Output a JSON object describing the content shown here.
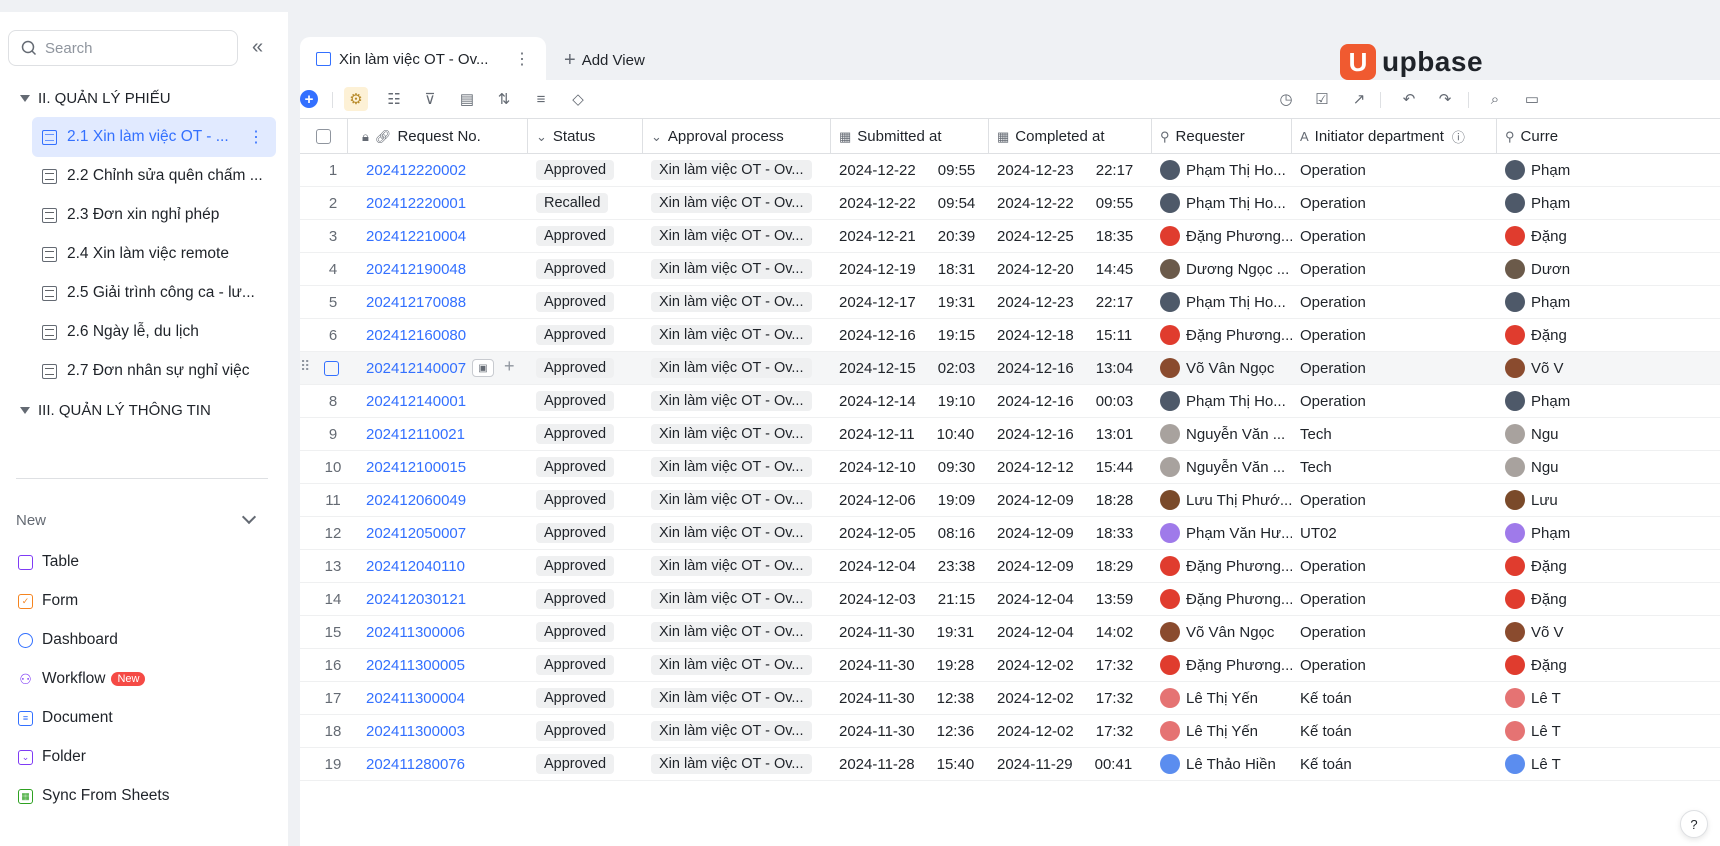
{
  "sidebar": {
    "search_placeholder": "Search",
    "groups": [
      {
        "label": "II. QUẢN LÝ PHIẾU"
      },
      {
        "label": "III. QUẢN LÝ THÔNG TIN"
      }
    ],
    "items": [
      {
        "label": "2.1 Xin làm việc OT - ..."
      },
      {
        "label": "2.2 Chỉnh sửa quên chấm ..."
      },
      {
        "label": "2.3 Đơn xin nghỉ phép"
      },
      {
        "label": "2.4 Xin làm việc remote"
      },
      {
        "label": "2.5 Giải trình công ca - lư..."
      },
      {
        "label": "2.6 Ngày lễ, du lịch"
      },
      {
        "label": "2.7 Đơn nhân sự nghỉ việc"
      }
    ],
    "new_label": "New",
    "new_items": [
      {
        "label": "Table",
        "icon": "table-icon",
        "color": "#7f3bf5"
      },
      {
        "label": "Form",
        "icon": "form-icon",
        "color": "#f5841f"
      },
      {
        "label": "Dashboard",
        "icon": "dashboard-icon",
        "color": "#3370ff"
      },
      {
        "label": "Workflow",
        "icon": "workflow-icon",
        "color": "#7f3bf5",
        "badge": "New"
      },
      {
        "label": "Document",
        "icon": "document-icon",
        "color": "#3370ff"
      },
      {
        "label": "Folder",
        "icon": "folder-icon",
        "color": "#7f3bf5"
      },
      {
        "label": "Sync From Sheets",
        "icon": "sheets-icon",
        "color": "#2ea121"
      }
    ]
  },
  "tabs": {
    "active_label": "Xin làm việc OT - Ov...",
    "add_view_label": "Add View"
  },
  "brand": {
    "name": "upbase",
    "color": "#f05a30"
  },
  "table": {
    "columns": [
      "Request No.",
      "Status",
      "Approval process",
      "Submitted at",
      "Completed at",
      "Requester",
      "Initiator department",
      "Curre"
    ],
    "rows": [
      {
        "n": "1",
        "req": "202412220002",
        "status": "Approved",
        "proc": "Xin làm việc OT - Ov...",
        "sd": "2024-12-22",
        "st": "09:55",
        "cd": "2024-12-23",
        "ct": "22:17",
        "requester": "Phạm Thị Ho...",
        "dept": "Operation",
        "cur": "Phạm",
        "av": "#4e5969"
      },
      {
        "n": "2",
        "req": "202412220001",
        "status": "Recalled",
        "proc": "Xin làm việc OT - Ov...",
        "sd": "2024-12-22",
        "st": "09:54",
        "cd": "2024-12-22",
        "ct": "09:55",
        "requester": "Phạm Thị Ho...",
        "dept": "Operation",
        "cur": "Phạm",
        "av": "#4e5969"
      },
      {
        "n": "3",
        "req": "202412210004",
        "status": "Approved",
        "proc": "Xin làm việc OT - Ov...",
        "sd": "2024-12-21",
        "st": "20:39",
        "cd": "2024-12-25",
        "ct": "18:35",
        "requester": "Đặng Phương...",
        "dept": "Operation",
        "cur": "Đặng",
        "av": "#e03c2e"
      },
      {
        "n": "4",
        "req": "202412190048",
        "status": "Approved",
        "proc": "Xin làm việc OT - Ov...",
        "sd": "2024-12-19",
        "st": "18:31",
        "cd": "2024-12-20",
        "ct": "14:45",
        "requester": "Dương Ngọc ...",
        "dept": "Operation",
        "cur": "Dươn",
        "av": "#6b5a4a"
      },
      {
        "n": "5",
        "req": "202412170088",
        "status": "Approved",
        "proc": "Xin làm việc OT - Ov...",
        "sd": "2024-12-17",
        "st": "19:31",
        "cd": "2024-12-23",
        "ct": "22:17",
        "requester": "Phạm Thị Ho...",
        "dept": "Operation",
        "cur": "Phạm",
        "av": "#4e5969"
      },
      {
        "n": "6",
        "req": "202412160080",
        "status": "Approved",
        "proc": "Xin làm việc OT - Ov...",
        "sd": "2024-12-16",
        "st": "19:15",
        "cd": "2024-12-18",
        "ct": "15:11",
        "requester": "Đặng Phương...",
        "dept": "Operation",
        "cur": "Đặng",
        "av": "#e03c2e"
      },
      {
        "n": "7",
        "req": "202412140007",
        "status": "Approved",
        "proc": "Xin làm việc OT - Ov...",
        "sd": "2024-12-15",
        "st": "02:03",
        "cd": "2024-12-16",
        "ct": "13:04",
        "requester": "Võ Vân Ngọc",
        "dept": "Operation",
        "cur": "Võ V",
        "av": "#8a4b2e"
      },
      {
        "n": "8",
        "req": "202412140001",
        "status": "Approved",
        "proc": "Xin làm việc OT - Ov...",
        "sd": "2024-12-14",
        "st": "19:10",
        "cd": "2024-12-16",
        "ct": "00:03",
        "requester": "Phạm Thị Ho...",
        "dept": "Operation",
        "cur": "Phạm",
        "av": "#4e5969"
      },
      {
        "n": "9",
        "req": "202412110021",
        "status": "Approved",
        "proc": "Xin làm việc OT - Ov...",
        "sd": "2024-12-11",
        "st": "10:40",
        "cd": "2024-12-16",
        "ct": "13:01",
        "requester": "Nguyễn Văn ...",
        "dept": "Tech",
        "cur": "Ngu",
        "av": "#a8a29e"
      },
      {
        "n": "10",
        "req": "202412100015",
        "status": "Approved",
        "proc": "Xin làm việc OT - Ov...",
        "sd": "2024-12-10",
        "st": "09:30",
        "cd": "2024-12-12",
        "ct": "15:44",
        "requester": "Nguyễn Văn ...",
        "dept": "Tech",
        "cur": "Ngu",
        "av": "#a8a29e"
      },
      {
        "n": "11",
        "req": "202412060049",
        "status": "Approved",
        "proc": "Xin làm việc OT - Ov...",
        "sd": "2024-12-06",
        "st": "19:09",
        "cd": "2024-12-09",
        "ct": "18:28",
        "requester": "Lưu Thị Phướ...",
        "dept": "Operation",
        "cur": "Lưu",
        "av": "#7a4a2a"
      },
      {
        "n": "12",
        "req": "202412050007",
        "status": "Approved",
        "proc": "Xin làm việc OT - Ov...",
        "sd": "2024-12-05",
        "st": "08:16",
        "cd": "2024-12-09",
        "ct": "18:33",
        "requester": "Phạm Văn Hư...",
        "dept": "UT02",
        "cur": "Phạm",
        "av": "#9f7aea"
      },
      {
        "n": "13",
        "req": "202412040110",
        "status": "Approved",
        "proc": "Xin làm việc OT - Ov...",
        "sd": "2024-12-04",
        "st": "23:38",
        "cd": "2024-12-09",
        "ct": "18:29",
        "requester": "Đặng Phương...",
        "dept": "Operation",
        "cur": "Đặng",
        "av": "#e03c2e"
      },
      {
        "n": "14",
        "req": "202412030121",
        "status": "Approved",
        "proc": "Xin làm việc OT - Ov...",
        "sd": "2024-12-03",
        "st": "21:15",
        "cd": "2024-12-04",
        "ct": "13:59",
        "requester": "Đặng Phương...",
        "dept": "Operation",
        "cur": "Đặng",
        "av": "#e03c2e"
      },
      {
        "n": "15",
        "req": "202411300006",
        "status": "Approved",
        "proc": "Xin làm việc OT - Ov...",
        "sd": "2024-11-30",
        "st": "19:31",
        "cd": "2024-12-04",
        "ct": "14:02",
        "requester": "Võ Vân Ngọc",
        "dept": "Operation",
        "cur": "Võ V",
        "av": "#8a4b2e"
      },
      {
        "n": "16",
        "req": "202411300005",
        "status": "Approved",
        "proc": "Xin làm việc OT - Ov...",
        "sd": "2024-11-30",
        "st": "19:28",
        "cd": "2024-12-02",
        "ct": "17:32",
        "requester": "Đặng Phương...",
        "dept": "Operation",
        "cur": "Đặng",
        "av": "#e03c2e"
      },
      {
        "n": "17",
        "req": "202411300004",
        "status": "Approved",
        "proc": "Xin làm việc OT - Ov...",
        "sd": "2024-11-30",
        "st": "12:38",
        "cd": "2024-12-02",
        "ct": "17:32",
        "requester": "Lê Thị Yến",
        "dept": "Kế toán",
        "cur": "Lê T",
        "av": "#e57373"
      },
      {
        "n": "18",
        "req": "202411300003",
        "status": "Approved",
        "proc": "Xin làm việc OT - Ov...",
        "sd": "2024-11-30",
        "st": "12:36",
        "cd": "2024-12-02",
        "ct": "17:32",
        "requester": "Lê Thị Yến",
        "dept": "Kế toán",
        "cur": "Lê T",
        "av": "#e57373"
      },
      {
        "n": "19",
        "req": "202411280076",
        "status": "Approved",
        "proc": "Xin làm việc OT - Ov...",
        "sd": "2024-11-28",
        "st": "15:40",
        "cd": "2024-11-29",
        "ct": "00:41",
        "requester": "Lê Thảo Hiền",
        "dept": "Kế toán",
        "cur": "Lê T",
        "av": "#5b8def"
      }
    ]
  }
}
